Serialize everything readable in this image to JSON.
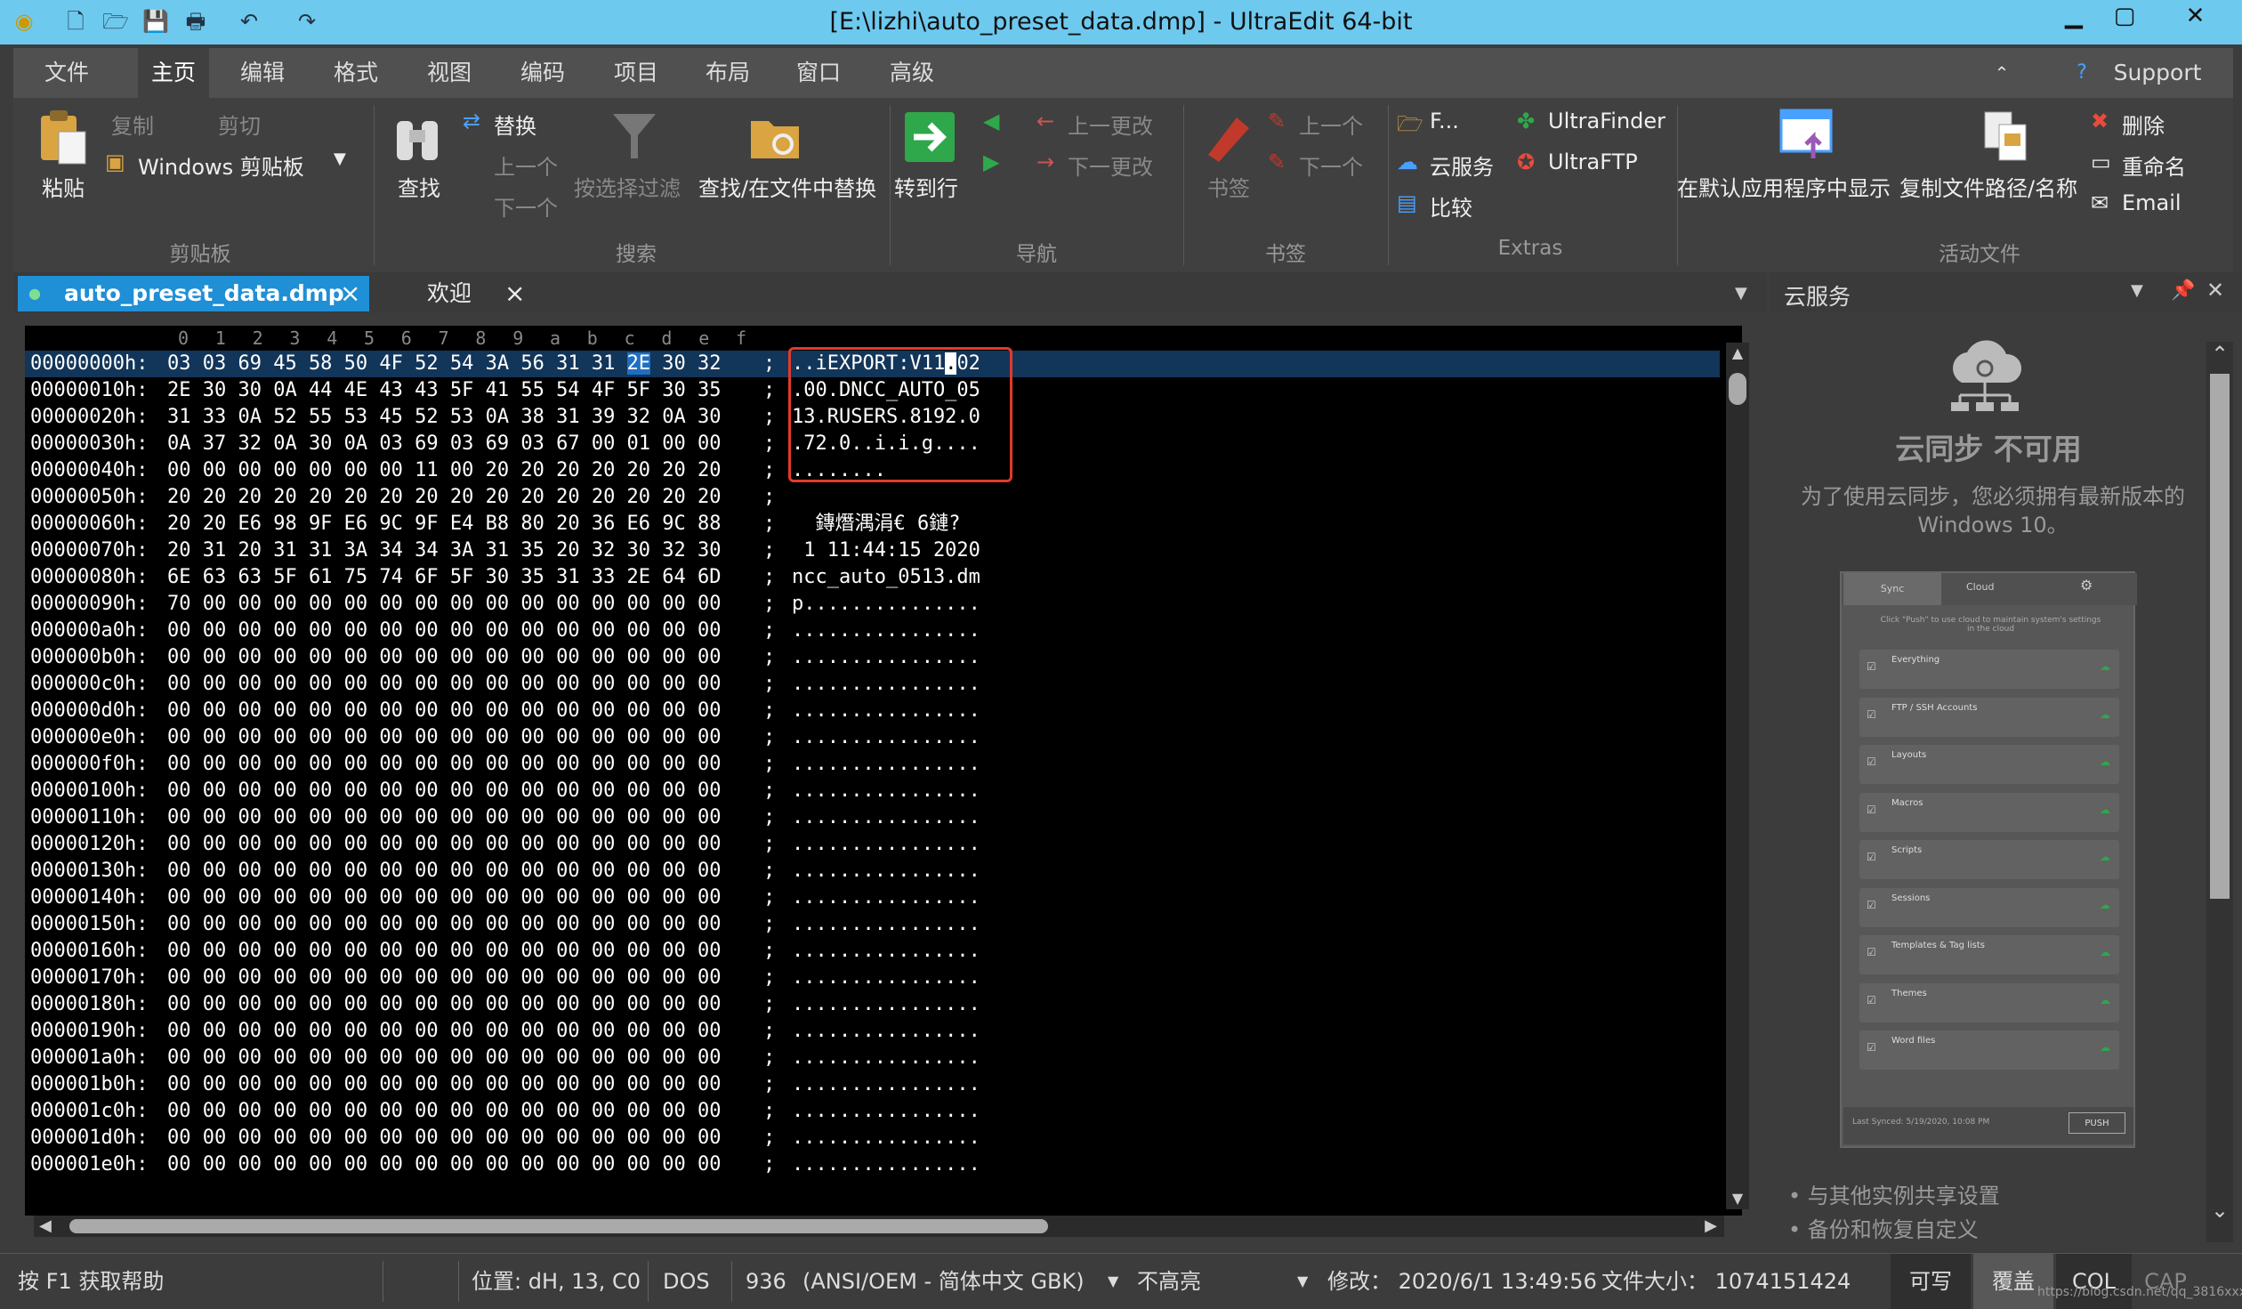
{
  "window": {
    "title": "[E:\\lizhi\\auto_preset_data.dmp] - UltraEdit 64-bit",
    "minimize": "▁",
    "maximize": "▢",
    "close": "✕"
  },
  "menu": [
    "文件(F)",
    "主页",
    "编辑",
    "格式",
    "视图",
    "编码",
    "项目",
    "布局",
    "窗口",
    "高级"
  ],
  "support": "Support",
  "ribbon": {
    "paste": "粘贴",
    "copy": "复制",
    "cut": "剪切",
    "clipboard": "Windows 剪贴板",
    "group_clipboard": "剪贴板",
    "find": "查找",
    "replace": "替换",
    "prev": "上一个",
    "next": "下一个",
    "filter": "按选择过滤",
    "find_in_files": "查找/在文件中替换",
    "group_search": "搜索",
    "goto": "转到行",
    "prev_change": "上一更改",
    "next_change": "下一更改",
    "group_nav": "导航",
    "bookmark": "书签",
    "bm_prev": "上一个",
    "bm_next": "下一个",
    "group_bookmark": "书签",
    "ftp": "F...",
    "cloud": "云服务",
    "compare": "比较",
    "ultrafinder": "UltraFinder",
    "ultraftp": "UltraFTP",
    "group_extras": "Extras",
    "show_in_app": "在默认应用程序中显示",
    "copy_path": "复制文件路径/名称",
    "delete": "删除",
    "rename": "重命名",
    "email": "Email",
    "group_active": "活动文件"
  },
  "tabs": [
    {
      "label": "auto_preset_data.dmp",
      "close": "×"
    },
    {
      "label": "欢迎",
      "close": "×"
    }
  ],
  "ruler": [
    "0",
    "1",
    "2",
    "3",
    "4",
    "5",
    "6",
    "7",
    "8",
    "9",
    "a",
    "b",
    "c",
    "d",
    "e",
    "f"
  ],
  "hex_rows": [
    {
      "off": "00000000h:",
      "hexA": "03 03 69 45 58 50 4F 52 54 3A 56 31 31 ",
      "hexH": "2E",
      "hexB": " 30 32",
      "sep": ";",
      "ascA": "..iEXPORT:V11",
      "ascH": ".",
      "ascB": "02"
    },
    {
      "off": "00000010h:",
      "hex": "2E 30 30 0A 44 4E 43 43 5F 41 55 54 4F 5F 30 35",
      "sep": ";",
      "asc": ".00.DNCC_AUTO_05"
    },
    {
      "off": "00000020h:",
      "hex": "31 33 0A 52 55 53 45 52 53 0A 38 31 39 32 0A 30",
      "sep": ";",
      "asc": "13.RUSERS.8192.0"
    },
    {
      "off": "00000030h:",
      "hex": "0A 37 32 0A 30 0A 03 69 03 69 03 67 00 01 00 00",
      "sep": ";",
      "asc": ".72.0..i.i.g...."
    },
    {
      "off": "00000040h:",
      "hex": "00 00 00 00 00 00 00 11 00 20 20 20 20 20 20 20",
      "sep": ";",
      "asc": "........        "
    },
    {
      "off": "00000050h:",
      "hex": "20 20 20 20 20 20 20 20 20 20 20 20 20 20 20 20",
      "sep": ";",
      "asc": "                "
    },
    {
      "off": "00000060h:",
      "hex": "20 20 E6 98 9F E6 9C 9F E4 B8 80 20 36 E6 9C 88",
      "sep": ";",
      "asc": "  鏄熸湡涓€ 6鏈?"
    },
    {
      "off": "00000070h:",
      "hex": "20 31 20 31 31 3A 34 34 3A 31 35 20 32 30 32 30",
      "sep": ";",
      "asc": " 1 11:44:15 2020"
    },
    {
      "off": "00000080h:",
      "hex": "6E 63 63 5F 61 75 74 6F 5F 30 35 31 33 2E 64 6D",
      "sep": ";",
      "asc": "ncc_auto_0513.dm"
    },
    {
      "off": "00000090h:",
      "hex": "70 00 00 00 00 00 00 00 00 00 00 00 00 00 00 00",
      "sep": ";",
      "asc": "p..............."
    },
    {
      "off": "000000a0h:",
      "hex": "00 00 00 00 00 00 00 00 00 00 00 00 00 00 00 00",
      "sep": ";",
      "asc": "................"
    },
    {
      "off": "000000b0h:",
      "hex": "00 00 00 00 00 00 00 00 00 00 00 00 00 00 00 00",
      "sep": ";",
      "asc": "................"
    },
    {
      "off": "000000c0h:",
      "hex": "00 00 00 00 00 00 00 00 00 00 00 00 00 00 00 00",
      "sep": ";",
      "asc": "................"
    },
    {
      "off": "000000d0h:",
      "hex": "00 00 00 00 00 00 00 00 00 00 00 00 00 00 00 00",
      "sep": ";",
      "asc": "................"
    },
    {
      "off": "000000e0h:",
      "hex": "00 00 00 00 00 00 00 00 00 00 00 00 00 00 00 00",
      "sep": ";",
      "asc": "................"
    },
    {
      "off": "000000f0h:",
      "hex": "00 00 00 00 00 00 00 00 00 00 00 00 00 00 00 00",
      "sep": ";",
      "asc": "................"
    },
    {
      "off": "00000100h:",
      "hex": "00 00 00 00 00 00 00 00 00 00 00 00 00 00 00 00",
      "sep": ";",
      "asc": "................"
    },
    {
      "off": "00000110h:",
      "hex": "00 00 00 00 00 00 00 00 00 00 00 00 00 00 00 00",
      "sep": ";",
      "asc": "................"
    },
    {
      "off": "00000120h:",
      "hex": "00 00 00 00 00 00 00 00 00 00 00 00 00 00 00 00",
      "sep": ";",
      "asc": "................"
    },
    {
      "off": "00000130h:",
      "hex": "00 00 00 00 00 00 00 00 00 00 00 00 00 00 00 00",
      "sep": ";",
      "asc": "................"
    },
    {
      "off": "00000140h:",
      "hex": "00 00 00 00 00 00 00 00 00 00 00 00 00 00 00 00",
      "sep": ";",
      "asc": "................"
    },
    {
      "off": "00000150h:",
      "hex": "00 00 00 00 00 00 00 00 00 00 00 00 00 00 00 00",
      "sep": ";",
      "asc": "................"
    },
    {
      "off": "00000160h:",
      "hex": "00 00 00 00 00 00 00 00 00 00 00 00 00 00 00 00",
      "sep": ";",
      "asc": "................"
    },
    {
      "off": "00000170h:",
      "hex": "00 00 00 00 00 00 00 00 00 00 00 00 00 00 00 00",
      "sep": ";",
      "asc": "................"
    },
    {
      "off": "00000180h:",
      "hex": "00 00 00 00 00 00 00 00 00 00 00 00 00 00 00 00",
      "sep": ";",
      "asc": "................"
    },
    {
      "off": "00000190h:",
      "hex": "00 00 00 00 00 00 00 00 00 00 00 00 00 00 00 00",
      "sep": ";",
      "asc": "................"
    },
    {
      "off": "000001a0h:",
      "hex": "00 00 00 00 00 00 00 00 00 00 00 00 00 00 00 00",
      "sep": ";",
      "asc": "................"
    },
    {
      "off": "000001b0h:",
      "hex": "00 00 00 00 00 00 00 00 00 00 00 00 00 00 00 00",
      "sep": ";",
      "asc": "................"
    },
    {
      "off": "000001c0h:",
      "hex": "00 00 00 00 00 00 00 00 00 00 00 00 00 00 00 00",
      "sep": ";",
      "asc": "................"
    },
    {
      "off": "000001d0h:",
      "hex": "00 00 00 00 00 00 00 00 00 00 00 00 00 00 00 00",
      "sep": ";",
      "asc": "................"
    },
    {
      "off": "000001e0h:",
      "hex": "00 00 00 00 00 00 00 00 00 00 00 00 00 00 00 00",
      "sep": ";",
      "asc": "................"
    }
  ],
  "cloud_panel": {
    "title": "云服务",
    "heading": "云同步 不可用",
    "message": "为了使用云同步，您必须拥有最新版本的 Windows 10。",
    "preview_tabs": [
      "Sync",
      "Cloud"
    ],
    "preview_note": "Click \"Push\" to use cloud to maintain system's settings in the cloud",
    "preview_items": [
      "Everything",
      "FTP / SSH Accounts",
      "Layouts",
      "Macros",
      "Scripts",
      "Sessions",
      "Templates & Tag lists",
      "Themes",
      "Word files"
    ],
    "preview_footer": "Last Synced: 5/19/2020, 10:08 PM",
    "preview_push": "PUSH",
    "bullets": [
      "与其他实例共享设置",
      "备份和恢复自定义"
    ]
  },
  "status": {
    "help": "按 F1 获取帮助",
    "position": "位置: dH, 13, C0",
    "line_end": "DOS",
    "codepage": "936",
    "encoding": "(ANSI/OEM - 简体中文 GBK)",
    "highlight": "不高亮",
    "modified": "修改： 2020/6/1 13:49:56",
    "filesize": "文件大小： 1074151424",
    "writable": "可写",
    "overwrite": "覆盖",
    "col": "COL",
    "cap": "CAP"
  },
  "watermark": "https://blog.csdn.net/qq_3816xxxx",
  "colors": {
    "titlebar": "#6ec9ee",
    "accent": "#1f6fc0",
    "highlight_box": "#e23a2a"
  }
}
